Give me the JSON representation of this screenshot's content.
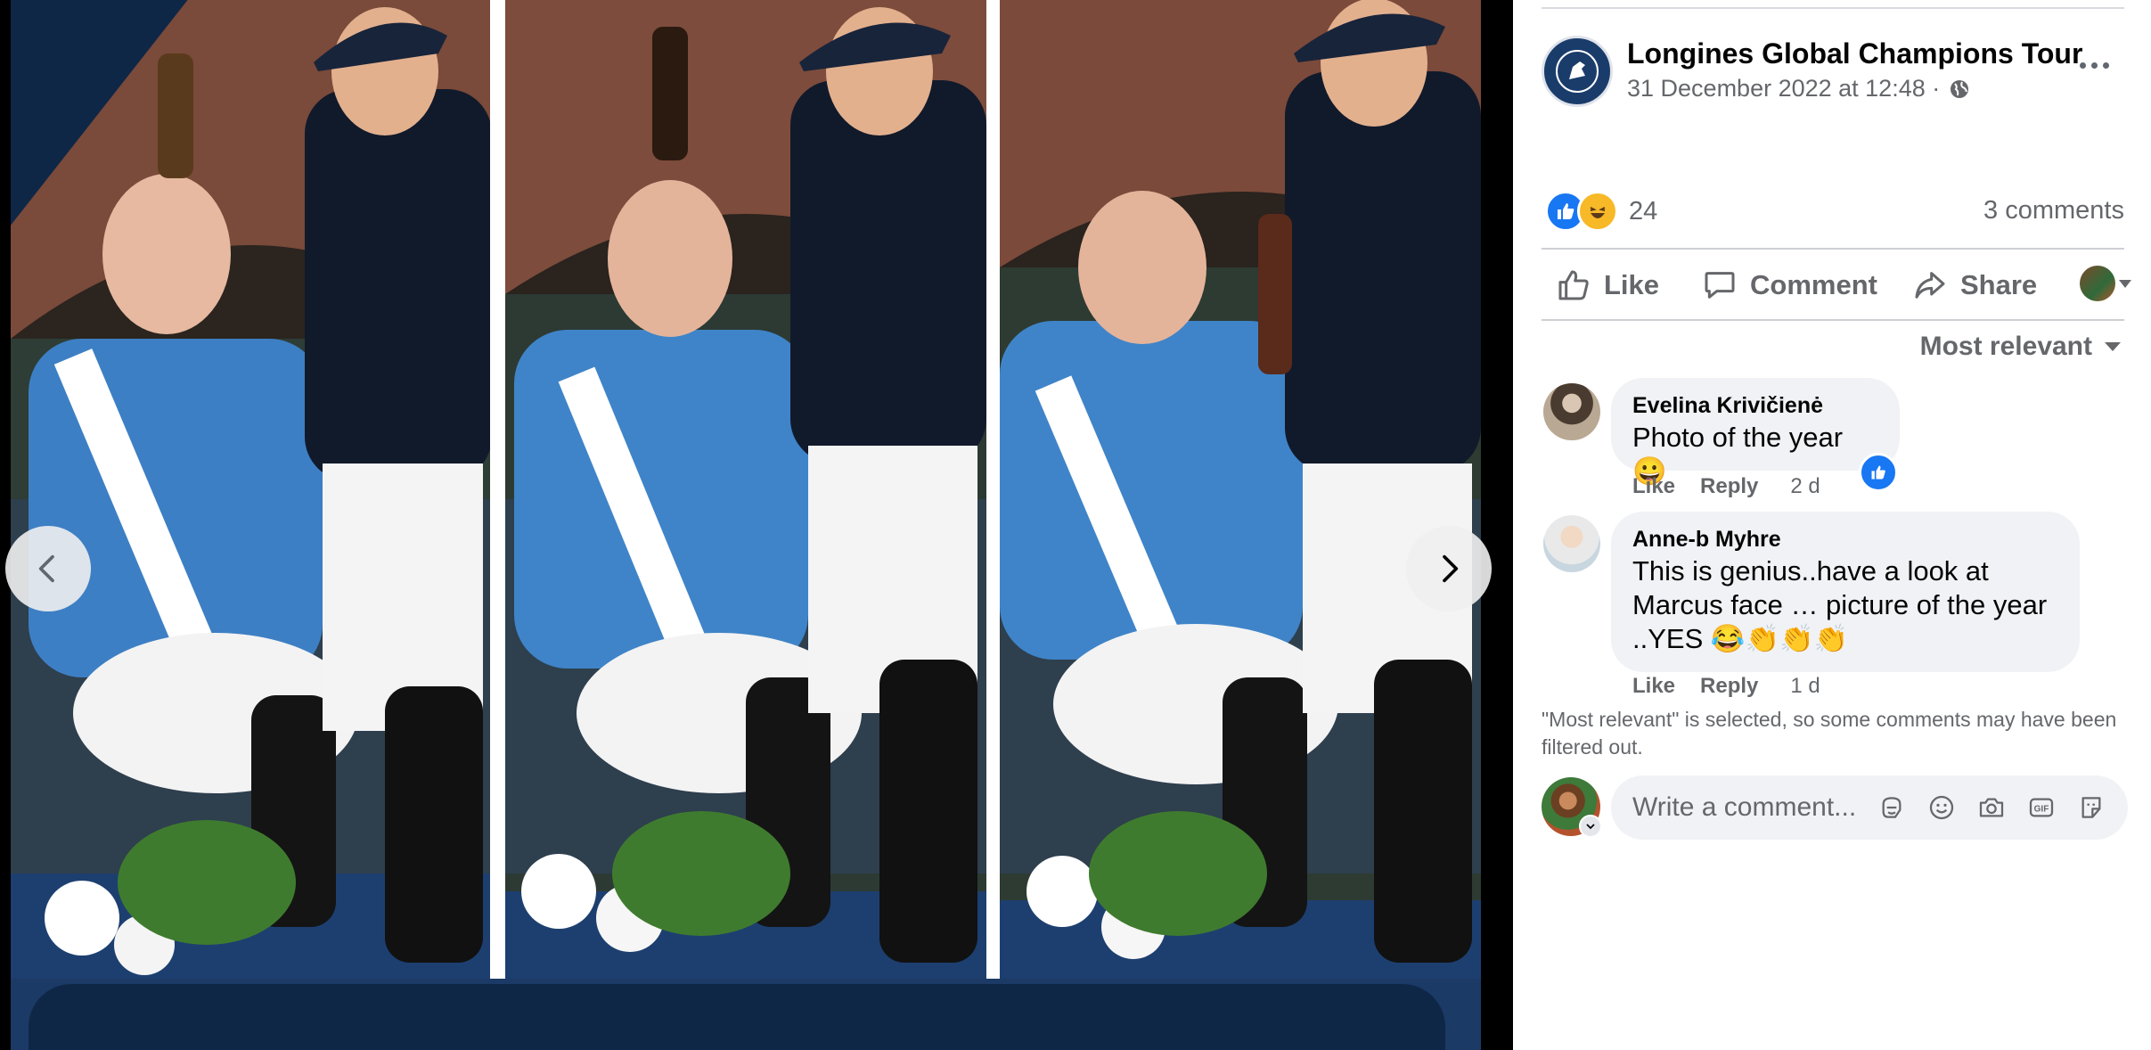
{
  "viewer": {
    "prev_label": "Previous photo",
    "next_label": "Next photo"
  },
  "post": {
    "page_name": "Longines Global Champions Tour",
    "timestamp": "31 December 2022 at 12:48 ·",
    "reaction_count": "24",
    "comments_count": "3 comments"
  },
  "actions": {
    "like": "Like",
    "comment": "Comment",
    "share": "Share"
  },
  "sort_label": "Most relevant",
  "comments": [
    {
      "name": "Evelina Krivičienė",
      "text": "Photo of the year",
      "emoji": "😀",
      "like": "Like",
      "reply": "Reply",
      "time": "2 d"
    },
    {
      "name": "Anne-b Myhre",
      "lines": [
        "This is genius..have a look at",
        "Marcus face … picture of the year",
        "..YES 😂👏👏👏"
      ],
      "like": "Like",
      "reply": "Reply",
      "time": "1 d"
    }
  ],
  "filter_note": "\"Most relevant\" is selected, so some comments may have been filtered out.",
  "composer": {
    "placeholder": "Write a comment..."
  },
  "colors": {
    "facebook_blue": "#1877f2",
    "secondary_text": "#65676b",
    "bubble_bg": "#f0f2f5",
    "brand_navy": "#0f2747"
  }
}
